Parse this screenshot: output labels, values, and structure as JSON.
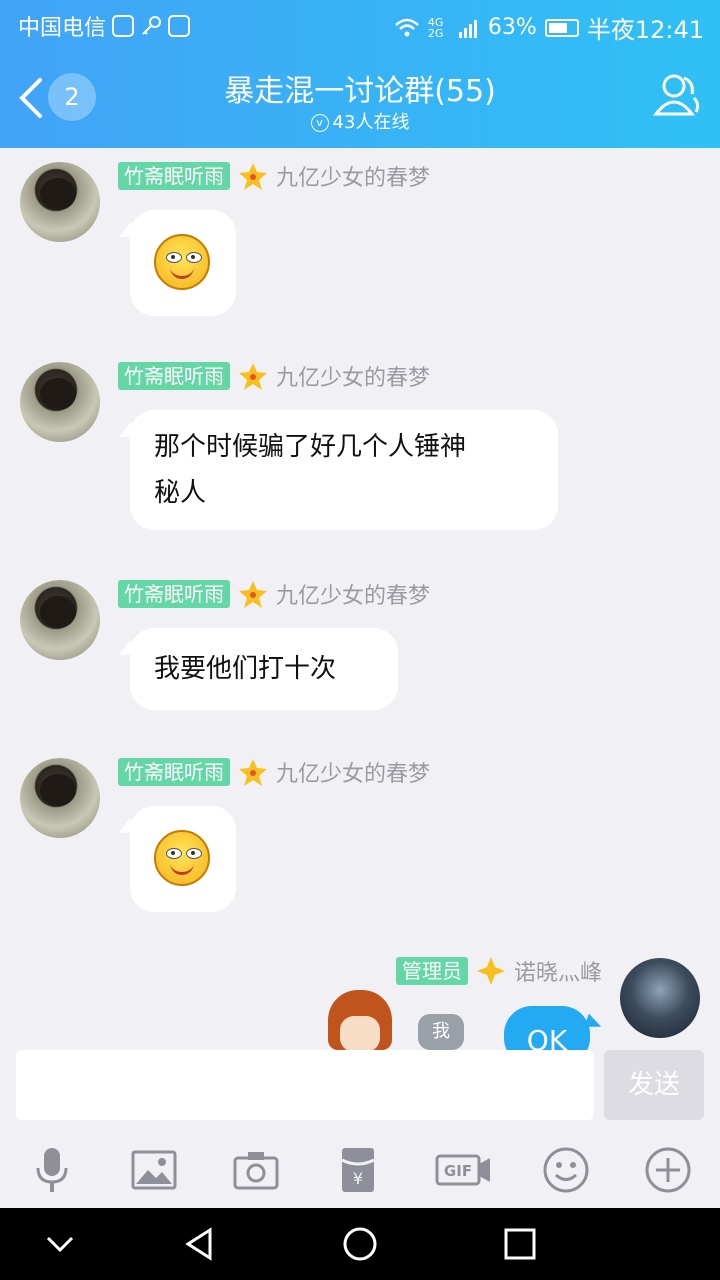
{
  "status": {
    "carrier": "中国电信",
    "network": "4G 2G",
    "battery": "63%",
    "time": "半夜12:41"
  },
  "header": {
    "back_count": "2",
    "title": "暴走混一讨论群(55)",
    "online": "43人在线"
  },
  "messages": [
    {
      "role": "竹斋眠听雨",
      "title": "九亿少女的春梦",
      "type": "emoji",
      "emoji": "smirk-emoji"
    },
    {
      "role": "竹斋眠听雨",
      "title": "九亿少女的春梦",
      "type": "text",
      "lines": [
        "那个时候骗了好几个人锤神",
        "秘人"
      ]
    },
    {
      "role": "竹斋眠听雨",
      "title": "九亿少女的春梦",
      "type": "text",
      "lines": [
        "我要他们打十次"
      ]
    },
    {
      "role": "竹斋眠听雨",
      "title": "九亿少女的春梦",
      "type": "emoji",
      "emoji": "smirk-emoji"
    }
  ],
  "self_message": {
    "role": "管理员",
    "name": "诺晓灬峰",
    "text": "OK",
    "sticker_tag": "我"
  },
  "input": {
    "placeholder": "",
    "send_label": "发送"
  },
  "toolbar": [
    "mic-icon",
    "image-icon",
    "camera-icon",
    "red-packet-icon",
    "gif-icon",
    "emoji-icon",
    "plus-icon"
  ],
  "colors": {
    "header_start": "#42a3f7",
    "header_end": "#2fc1f5",
    "role_badge": "#63d7a6",
    "self_bubble": "#23aaf2"
  }
}
